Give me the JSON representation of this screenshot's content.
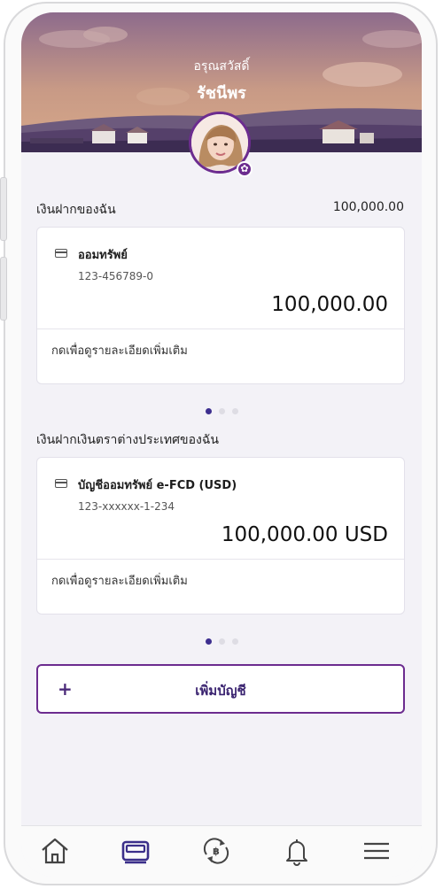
{
  "header": {
    "greeting": "อรุณสวัสดิ์",
    "user_name": "รัชนีพร"
  },
  "deposits": {
    "title": "เงินฝากของฉัน",
    "total": "100,000.00",
    "card": {
      "icon": "card-icon",
      "account_name": "ออมทรัพย์",
      "account_number": "123-456789-0",
      "balance": "100,000.00",
      "detail_label": "กดเพื่อดูรายละเอียดเพิ่มเติม"
    },
    "pager": {
      "count": 3,
      "active": 1
    }
  },
  "foreign_deposits": {
    "title": "เงินฝากเงินตราต่างประเทศของฉัน",
    "card": {
      "icon": "card-icon",
      "account_name": "บัญชีออมทรัพย์ e-FCD (USD)",
      "account_number": "123-xxxxxx-1-234",
      "balance": "100,000.00 USD",
      "detail_label": "กดเพื่อดูรายละเอียดเพิ่มเติม"
    },
    "pager": {
      "count": 3,
      "active": 1
    }
  },
  "add_account": {
    "icon": "plus-icon",
    "label": "เพิ่มบัญชี"
  },
  "nav": {
    "items": [
      {
        "name": "home",
        "icon": "home-icon",
        "active": false
      },
      {
        "name": "accounts",
        "icon": "wallet-card-icon",
        "active": true
      },
      {
        "name": "transfer",
        "icon": "baht-exchange-icon",
        "active": false
      },
      {
        "name": "notifications",
        "icon": "bell-icon",
        "active": false
      },
      {
        "name": "menu",
        "icon": "hamburger-menu-icon",
        "active": false
      }
    ]
  },
  "colors": {
    "brand_purple": "#6c2c8f",
    "active_dot": "#3d2f8f",
    "background": "#f3f2f7"
  }
}
